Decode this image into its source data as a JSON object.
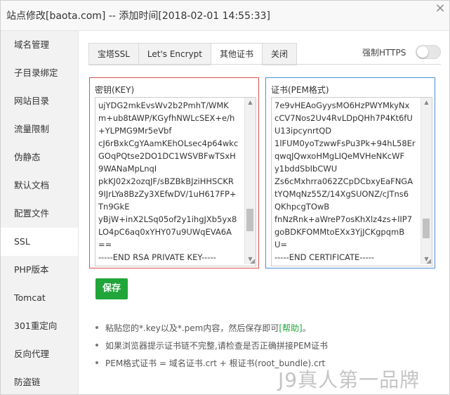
{
  "window": {
    "title": "站点修改[baota.com] -- 添加时间[2018-02-01 14:55:33]",
    "close_glyph": "×"
  },
  "sidebar": {
    "items": [
      {
        "label": "域名管理"
      },
      {
        "label": "子目录绑定"
      },
      {
        "label": "网站目录"
      },
      {
        "label": "流量限制"
      },
      {
        "label": "伪静态"
      },
      {
        "label": "默认文档"
      },
      {
        "label": "配置文件"
      },
      {
        "label": "SSL",
        "active": true
      },
      {
        "label": "PHP版本"
      },
      {
        "label": "Tomcat"
      },
      {
        "label": "301重定向"
      },
      {
        "label": "反向代理"
      },
      {
        "label": "防盗链"
      }
    ]
  },
  "tabs": [
    {
      "label": "宝塔SSL"
    },
    {
      "label": "Let's Encrypt"
    },
    {
      "label": "其他证书",
      "active": true
    },
    {
      "label": "关闭"
    }
  ],
  "force_https": {
    "label": "强制HTTPS",
    "enabled": false
  },
  "key_box": {
    "label": "密钥(KEY)",
    "value": "ujYDG2mkEvsWv2b2PmhT/WMK\nm+ub8tAWP/KGyfhNWLcSEX+e/h\n+YLPMG9Mr5eVbf\ncJ6rBxkCgYAamKEhOLsec4p64wkc\nGOqPQtse2DO1DC1WSVBFwTSxH\n9WANaMpLnqI\npkKJ02x2ozqJF/sBZBkBJziHHSCKR\n9IJrLYa8BzZy3XEfwDV/1uH617FP+\nTn9GkE\nyBjW+inX2LSq05of2y1ihgJXb5yx8\nLO4pC6aq0xYHY07u9UWqEVA6A\n==\n-----END RSA PRIVATE KEY-----"
  },
  "cert_box": {
    "label": "证书(PEM格式)",
    "value": "7e9vHEAoGyysMO6HzPWYMkyNx\ncCV7Nos2Uv4RvLDpQHh7P4Kt6fU\nU13ipcynrtQD\n1lFUM0yoTzwwFsPu3Pk+94hL58Er\nqwqJQwxoHMgLIQeMVHeNKcWF\ny1bddSbIbCWU\nZs6cMxhrra062ZCpDCbxyEaFNGA\ntYQMqNz55Z/14XgSUONZ/cJTns6\nQKhpcgTOwB\nfnNzRnk+aWreP7osKhXlz4zs+lIP7\ngoBDKFOMMtoEXx3YjJCKgpqmB\nU=\n-----END CERTIFICATE-----"
  },
  "save_button": {
    "label": "保存"
  },
  "notes": [
    {
      "text": "粘贴您的*.key以及*.pem内容，然后保存即可",
      "link": "[帮助]",
      "end": "。"
    },
    {
      "text": "如果浏览器提示证书链不完整,请检查是否正确拼接PEM证书"
    },
    {
      "text": "PEM格式证书 = 域名证书.crt + 根证书(root_bundle).crt"
    }
  ],
  "watermark": "J9真人第一品牌",
  "colors": {
    "accent": "#20a53a",
    "key_border": "#d9534f",
    "cert_border": "#4a90d9"
  }
}
